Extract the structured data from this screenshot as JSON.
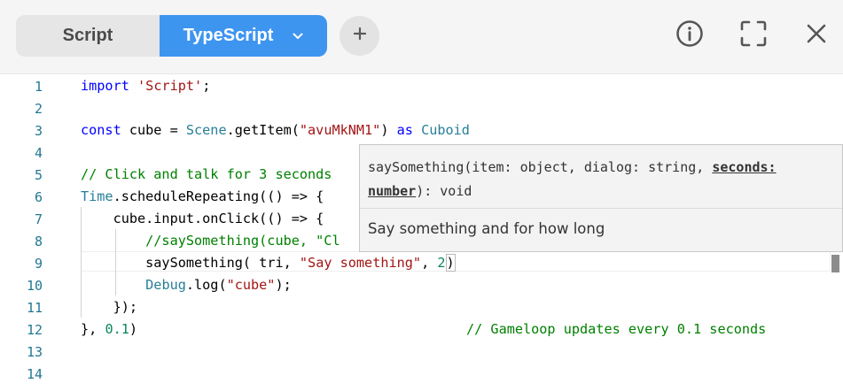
{
  "tabs": {
    "script_label": "Script",
    "typescript_label": "TypeScript"
  },
  "icons": {
    "chevron": "chevron-down-icon",
    "add": "plus-icon",
    "info": "info-icon",
    "fullscreen": "fullscreen-icon",
    "close": "close-icon"
  },
  "colors": {
    "accent": "#3d95f0",
    "keyword": "#0000ff",
    "string": "#a31515",
    "type": "#267f99",
    "comment": "#008000",
    "number": "#098658"
  },
  "editor": {
    "line_numbers": [
      "1",
      "2",
      "3",
      "4",
      "5",
      "6",
      "7",
      "8",
      "9",
      "10",
      "11",
      "12",
      "13",
      "14"
    ],
    "l1": {
      "kw": "import",
      "sp": " ",
      "str": "'Script'",
      "end": ";"
    },
    "l3": {
      "kw": "const",
      "mid": " cube = ",
      "cls": "Scene",
      "call": ".getItem(",
      "str": "\"avuMkNM1\"",
      "close": ") ",
      "as": "as",
      "sp": " ",
      "type": "Cuboid"
    },
    "l5": {
      "cmt": "// Click and talk for 3 seconds"
    },
    "l6": {
      "cls": "Time",
      "rest": ".scheduleRepeating(() => {"
    },
    "l7": {
      "text": "    cube.input.onClick(() => {"
    },
    "l8": {
      "cmt": "        //saySomething(cube, \"Cl"
    },
    "l9": {
      "pre": "        saySomething(",
      "mid": " tri, ",
      "str": "\"Say something\"",
      "comma": ", ",
      "num": "2",
      "close": ")"
    },
    "l10": {
      "pre": "        ",
      "cls": "Debug",
      "call": ".log(",
      "str": "\"cube\"",
      "end": ");"
    },
    "l11": {
      "text": "    });"
    },
    "l12": {
      "pre": "}, ",
      "num": "0.1",
      "close": ")",
      "cmt": "// Gameloop updates every 0.1 seconds"
    }
  },
  "tooltip": {
    "sig_pre": "saySomething(item: object, dialog: string, ",
    "sig_active": "seconds: number",
    "sig_post": "): void",
    "doc": "Say something and for how long"
  }
}
